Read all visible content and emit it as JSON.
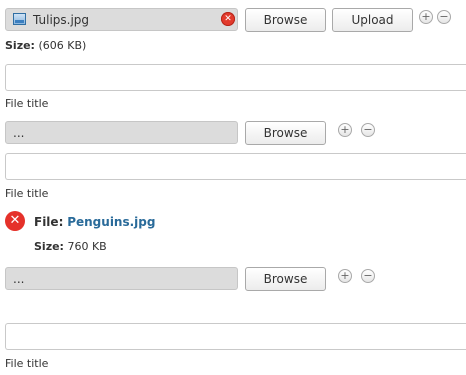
{
  "upload1": {
    "file_name": "Tulips.jpg",
    "clear_glyph": "✕",
    "browse_label": "Browse",
    "upload_label": "Upload",
    "add_glyph": "+",
    "remove_glyph": "−",
    "size_label": "Size:",
    "size_value": "(606 KB)",
    "title_label": "File title",
    "title_value": ""
  },
  "upload2": {
    "file_name": "...",
    "browse_label": "Browse",
    "add_glyph": "+",
    "remove_glyph": "−",
    "title_label": "File title",
    "title_value": ""
  },
  "error_item": {
    "icon_glyph": "✕",
    "file_label": "File:",
    "file_name": "Penguins.jpg",
    "size_label": "Size:",
    "size_value": "760 KB"
  },
  "upload3": {
    "file_name": "...",
    "browse_label": "Browse",
    "add_glyph": "+",
    "remove_glyph": "−",
    "title_label": "File title",
    "title_value": ""
  }
}
